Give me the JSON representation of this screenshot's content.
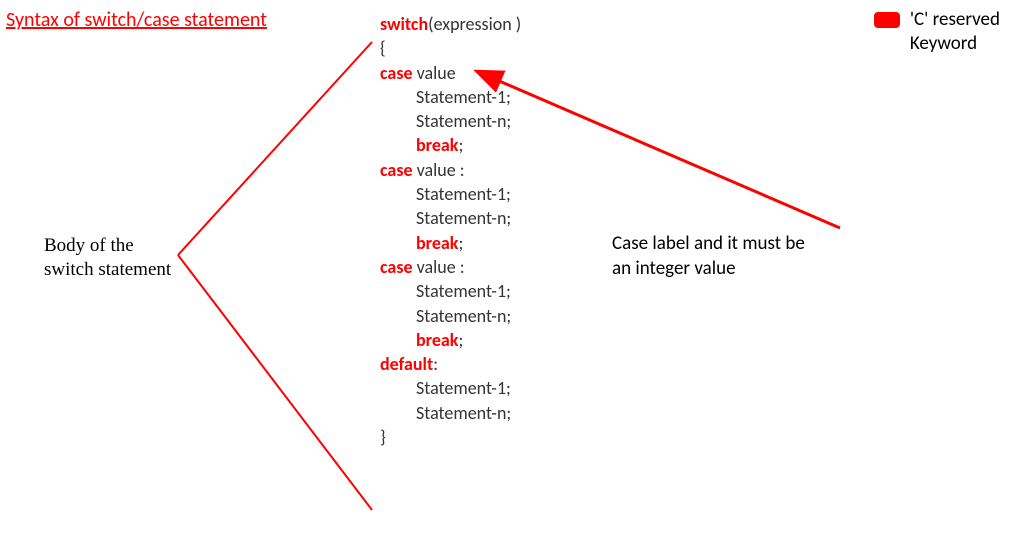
{
  "title": "Syntax of switch/case statement",
  "legend": {
    "line1": "'C' reserved",
    "line2": "Keyword"
  },
  "body_label": {
    "line1": "Body of the",
    "line2": "switch statement"
  },
  "case_label": {
    "line1": "Case label and it must be",
    "line2": "an integer value"
  },
  "code": {
    "l1_kw": "switch",
    "l1_rest": "(expression )",
    "l2": "{",
    "l3_kw": "case",
    "l3_rest": " value ",
    "l4": "Statement-1;",
    "l5": "Statement-n;",
    "l6_kw": "break",
    "l6_rest": ";",
    "l7_kw": "case",
    "l7_rest": " value :",
    "l8": "Statement-1;",
    "l9": "Statement-n;",
    "l10_kw": "break",
    "l10_rest": ";",
    "l11_kw": "case",
    "l11_rest": " value :",
    "l12": "Statement-1;",
    "l13": "Statement-n;",
    "l14_kw": "break",
    "l14_rest": ";",
    "l15_kw": "default",
    "l15_rest": ":",
    "l16": "Statement-1;",
    "l17": "Statement-n;",
    "l18": "}"
  },
  "colors": {
    "accent": "#ff0000"
  }
}
